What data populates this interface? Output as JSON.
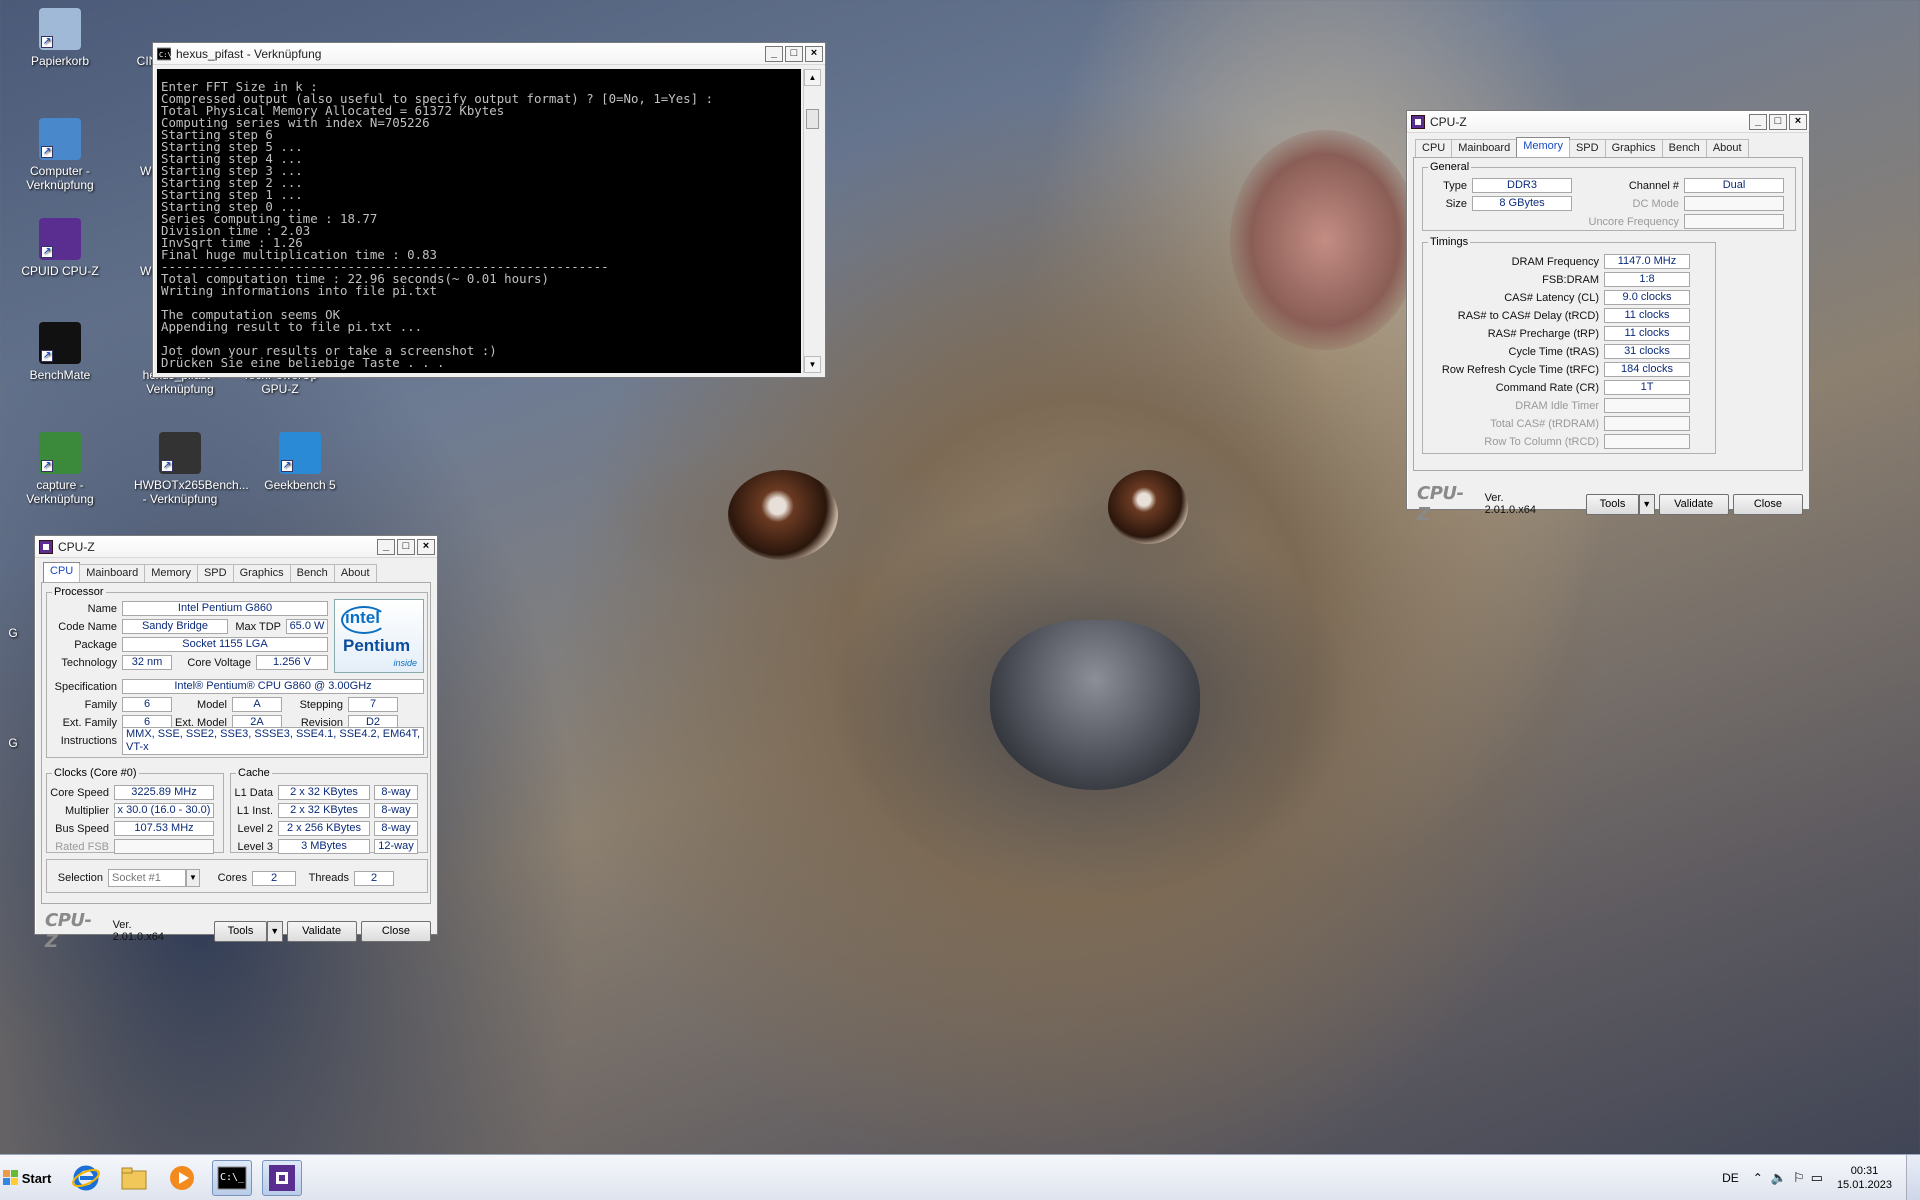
{
  "desktop_icons": [
    {
      "label": "Papierkorb",
      "icon": "recycle-bin-icon"
    },
    {
      "label": "CIN",
      "icon": "cinebench-icon"
    },
    {
      "label": "Computer - Verknüpfung",
      "icon": "computer-icon"
    },
    {
      "label": "Wi",
      "icon": "app-icon"
    },
    {
      "label": "CPUID CPU-Z",
      "icon": "cpuz-icon"
    },
    {
      "label": "Wi",
      "icon": "app-icon"
    },
    {
      "label": "BenchMate",
      "icon": "benchmate-icon"
    },
    {
      "label": "hexus_pifast - Verknüpfung",
      "icon": "console-icon"
    },
    {
      "label": "TechPowerUp GPU-Z",
      "icon": "gpuz-icon"
    },
    {
      "label": "capture - Verknüpfung",
      "icon": "capture-icon"
    },
    {
      "label": "HWBOTx265Bench... - Verknüpfung",
      "icon": "hwbot-icon"
    },
    {
      "label": "Geekbench 5",
      "icon": "geekbench-icon"
    },
    {
      "label": "G",
      "icon": "app-icon"
    },
    {
      "label": "G",
      "icon": "app-icon"
    }
  ],
  "console_window": {
    "title": "hexus_pifast - Verknüpfung",
    "lines": [
      "Enter FFT Size in k :",
      "Compressed output (also useful to specify output format) ? [0=No, 1=Yes] :",
      "Total Physical Memory Allocated = 61372 Kbytes",
      "Computing series with index N=705226",
      "Starting step 6",
      "Starting step 5 ...",
      "Starting step 4 ...",
      "Starting step 3 ...",
      "Starting step 2 ...",
      "Starting step 1 ...",
      "Starting step 0 ...",
      "Series computing time : 18.77",
      "Division time : 2.03",
      "InvSqrt time : 1.26",
      "Final huge multiplication time : 0.83",
      "------------------------------------------------------------",
      "Total computation time : 22.96 seconds(~ 0.01 hours)",
      "Writing informations into file pi.txt",
      "",
      "The computation seems OK",
      "Appending result to file pi.txt ...",
      "",
      "Jot down your results or take a screenshot :)",
      "Drücken Sie eine beliebige Taste . . ."
    ]
  },
  "cpuz_memory": {
    "title": "CPU-Z",
    "tabs": [
      "CPU",
      "Mainboard",
      "Memory",
      "SPD",
      "Graphics",
      "Bench",
      "About"
    ],
    "active_tab": "Memory",
    "general_legend": "General",
    "type_label": "Type",
    "type": "DDR3",
    "size_label": "Size",
    "size": "8 GBytes",
    "channel_label": "Channel #",
    "channel": "Dual",
    "dcmode_label": "DC Mode",
    "dcmode": "",
    "uncore_label": "Uncore Frequency",
    "uncore": "",
    "timings_legend": "Timings",
    "timings": [
      {
        "label": "DRAM Frequency",
        "value": "1147.0 MHz",
        "enabled": true
      },
      {
        "label": "FSB:DRAM",
        "value": "1:8",
        "enabled": true
      },
      {
        "label": "CAS# Latency (CL)",
        "value": "9.0 clocks",
        "enabled": true
      },
      {
        "label": "RAS# to CAS# Delay (tRCD)",
        "value": "11 clocks",
        "enabled": true
      },
      {
        "label": "RAS# Precharge (tRP)",
        "value": "11 clocks",
        "enabled": true
      },
      {
        "label": "Cycle Time (tRAS)",
        "value": "31 clocks",
        "enabled": true
      },
      {
        "label": "Row Refresh Cycle Time (tRFC)",
        "value": "184 clocks",
        "enabled": true
      },
      {
        "label": "Command Rate (CR)",
        "value": "1T",
        "enabled": true
      },
      {
        "label": "DRAM Idle Timer",
        "value": "",
        "enabled": false
      },
      {
        "label": "Total CAS# (tRDRAM)",
        "value": "",
        "enabled": false
      },
      {
        "label": "Row To Column (tRCD)",
        "value": "",
        "enabled": false
      }
    ],
    "logo": "CPU-Z",
    "version": "Ver. 2.01.0.x64",
    "tools": "Tools",
    "validate": "Validate",
    "close": "Close"
  },
  "cpuz_cpu": {
    "title": "CPU-Z",
    "tabs": [
      "CPU",
      "Mainboard",
      "Memory",
      "SPD",
      "Graphics",
      "Bench",
      "About"
    ],
    "active_tab": "CPU",
    "processor_legend": "Processor",
    "name_label": "Name",
    "name": "Intel Pentium G860",
    "codename_label": "Code Name",
    "codename": "Sandy Bridge",
    "maxtdp_label": "Max TDP",
    "maxtdp": "65.0 W",
    "package_label": "Package",
    "package": "Socket 1155 LGA",
    "tech_label": "Technology",
    "tech": "32 nm",
    "voltage_label": "Core Voltage",
    "voltage": "1.256 V",
    "spec_label": "Specification",
    "spec": "Intel® Pentium® CPU G860 @ 3.00GHz",
    "family_label": "Family",
    "family": "6",
    "model_label": "Model",
    "model": "A",
    "stepping_label": "Stepping",
    "stepping": "7",
    "extfamily_label": "Ext. Family",
    "extfamily": "6",
    "extmodel_label": "Ext. Model",
    "extmodel": "2A",
    "revision_label": "Revision",
    "revision": "D2",
    "instr_label": "Instructions",
    "instructions": "MMX, SSE, SSE2, SSE3, SSSE3, SSE4.1, SSE4.2, EM64T, VT-x",
    "badge_brand": "intel",
    "badge_product": "Pentium",
    "badge_sub": "inside",
    "clocks_legend": "Clocks (Core #0)",
    "corespeed_label": "Core Speed",
    "corespeed": "3225.89 MHz",
    "multiplier_label": "Multiplier",
    "multiplier": "x 30.0 (16.0 - 30.0)",
    "busspeed_label": "Bus Speed",
    "busspeed": "107.53 MHz",
    "ratedfsb_label": "Rated FSB",
    "ratedfsb": "",
    "cache_legend": "Cache",
    "cache": [
      {
        "label": "L1 Data",
        "size": "2 x 32 KBytes",
        "way": "8-way"
      },
      {
        "label": "L1 Inst.",
        "size": "2 x 32 KBytes",
        "way": "8-way"
      },
      {
        "label": "Level 2",
        "size": "2 x 256 KBytes",
        "way": "8-way"
      },
      {
        "label": "Level 3",
        "size": "3 MBytes",
        "way": "12-way"
      }
    ],
    "selection_label": "Selection",
    "selection": "Socket #1",
    "cores_label": "Cores",
    "cores": "2",
    "threads_label": "Threads",
    "threads": "2",
    "logo": "CPU-Z",
    "version": "Ver. 2.01.0.x64",
    "tools": "Tools",
    "validate": "Validate",
    "close": "Close"
  },
  "taskbar": {
    "start_label": "Start",
    "lang": "DE",
    "time": "00:31",
    "date": "15.01.2023"
  }
}
